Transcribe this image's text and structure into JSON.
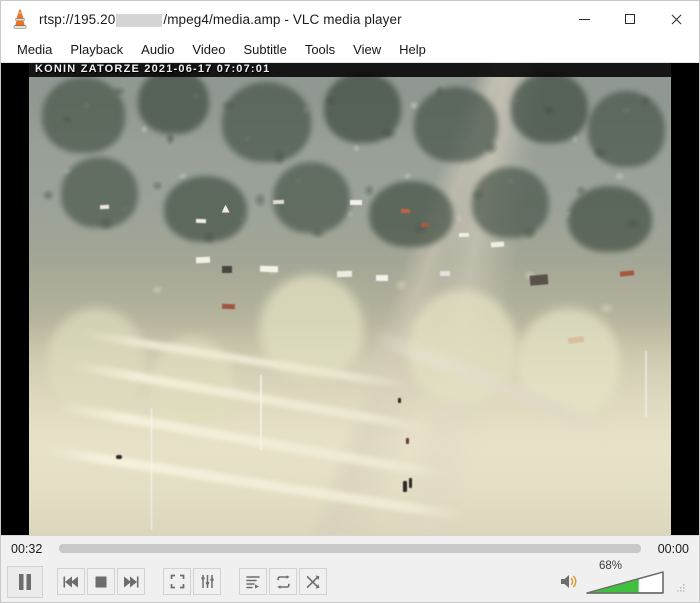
{
  "window": {
    "title_prefix": "rtsp://195.20",
    "title_suffix": "/mpeg4/media.amp - VLC media player",
    "app_icon": "vlc-cone-icon",
    "minimize_label": "Minimize",
    "maximize_label": "Maximize",
    "close_label": "Close"
  },
  "menubar": {
    "items": [
      {
        "label": "Media"
      },
      {
        "label": "Playback"
      },
      {
        "label": "Audio"
      },
      {
        "label": "Video"
      },
      {
        "label": "Subtitle"
      },
      {
        "label": "Tools"
      },
      {
        "label": "View"
      },
      {
        "label": "Help"
      }
    ]
  },
  "video": {
    "osd_overlay": "KONIN  ZATORZE  2021-06-17 07:07:01",
    "letterbox_color": "#000000",
    "description": "Aerial surveillance view of a wooded hillside with scattered houses and a path"
  },
  "seekbar": {
    "elapsed": "00:32",
    "remaining": "00:00",
    "progress_percent": 0
  },
  "controls": {
    "play_pause": {
      "label": "Pause",
      "icon": "pause-icon"
    },
    "previous": {
      "label": "Previous",
      "icon": "previous-icon"
    },
    "stop": {
      "label": "Stop",
      "icon": "stop-icon"
    },
    "next": {
      "label": "Next",
      "icon": "next-icon"
    },
    "fullscreen": {
      "label": "Toggle fullscreen",
      "icon": "fullscreen-icon"
    },
    "effects": {
      "label": "Show extended settings",
      "icon": "equalizer-icon"
    },
    "playlist": {
      "label": "Show playlist",
      "icon": "playlist-icon"
    },
    "loop": {
      "label": "Loop",
      "icon": "loop-icon"
    },
    "shuffle": {
      "label": "Random",
      "icon": "shuffle-icon"
    }
  },
  "volume": {
    "icon": "speaker-icon",
    "level_label": "68%",
    "level_percent": 68,
    "fill_color": "#3fc03f",
    "track_color": "#ffffff",
    "outline_color": "#6d6d6d"
  },
  "statusbar": {
    "resize_grip": "resize-grip-icon"
  }
}
